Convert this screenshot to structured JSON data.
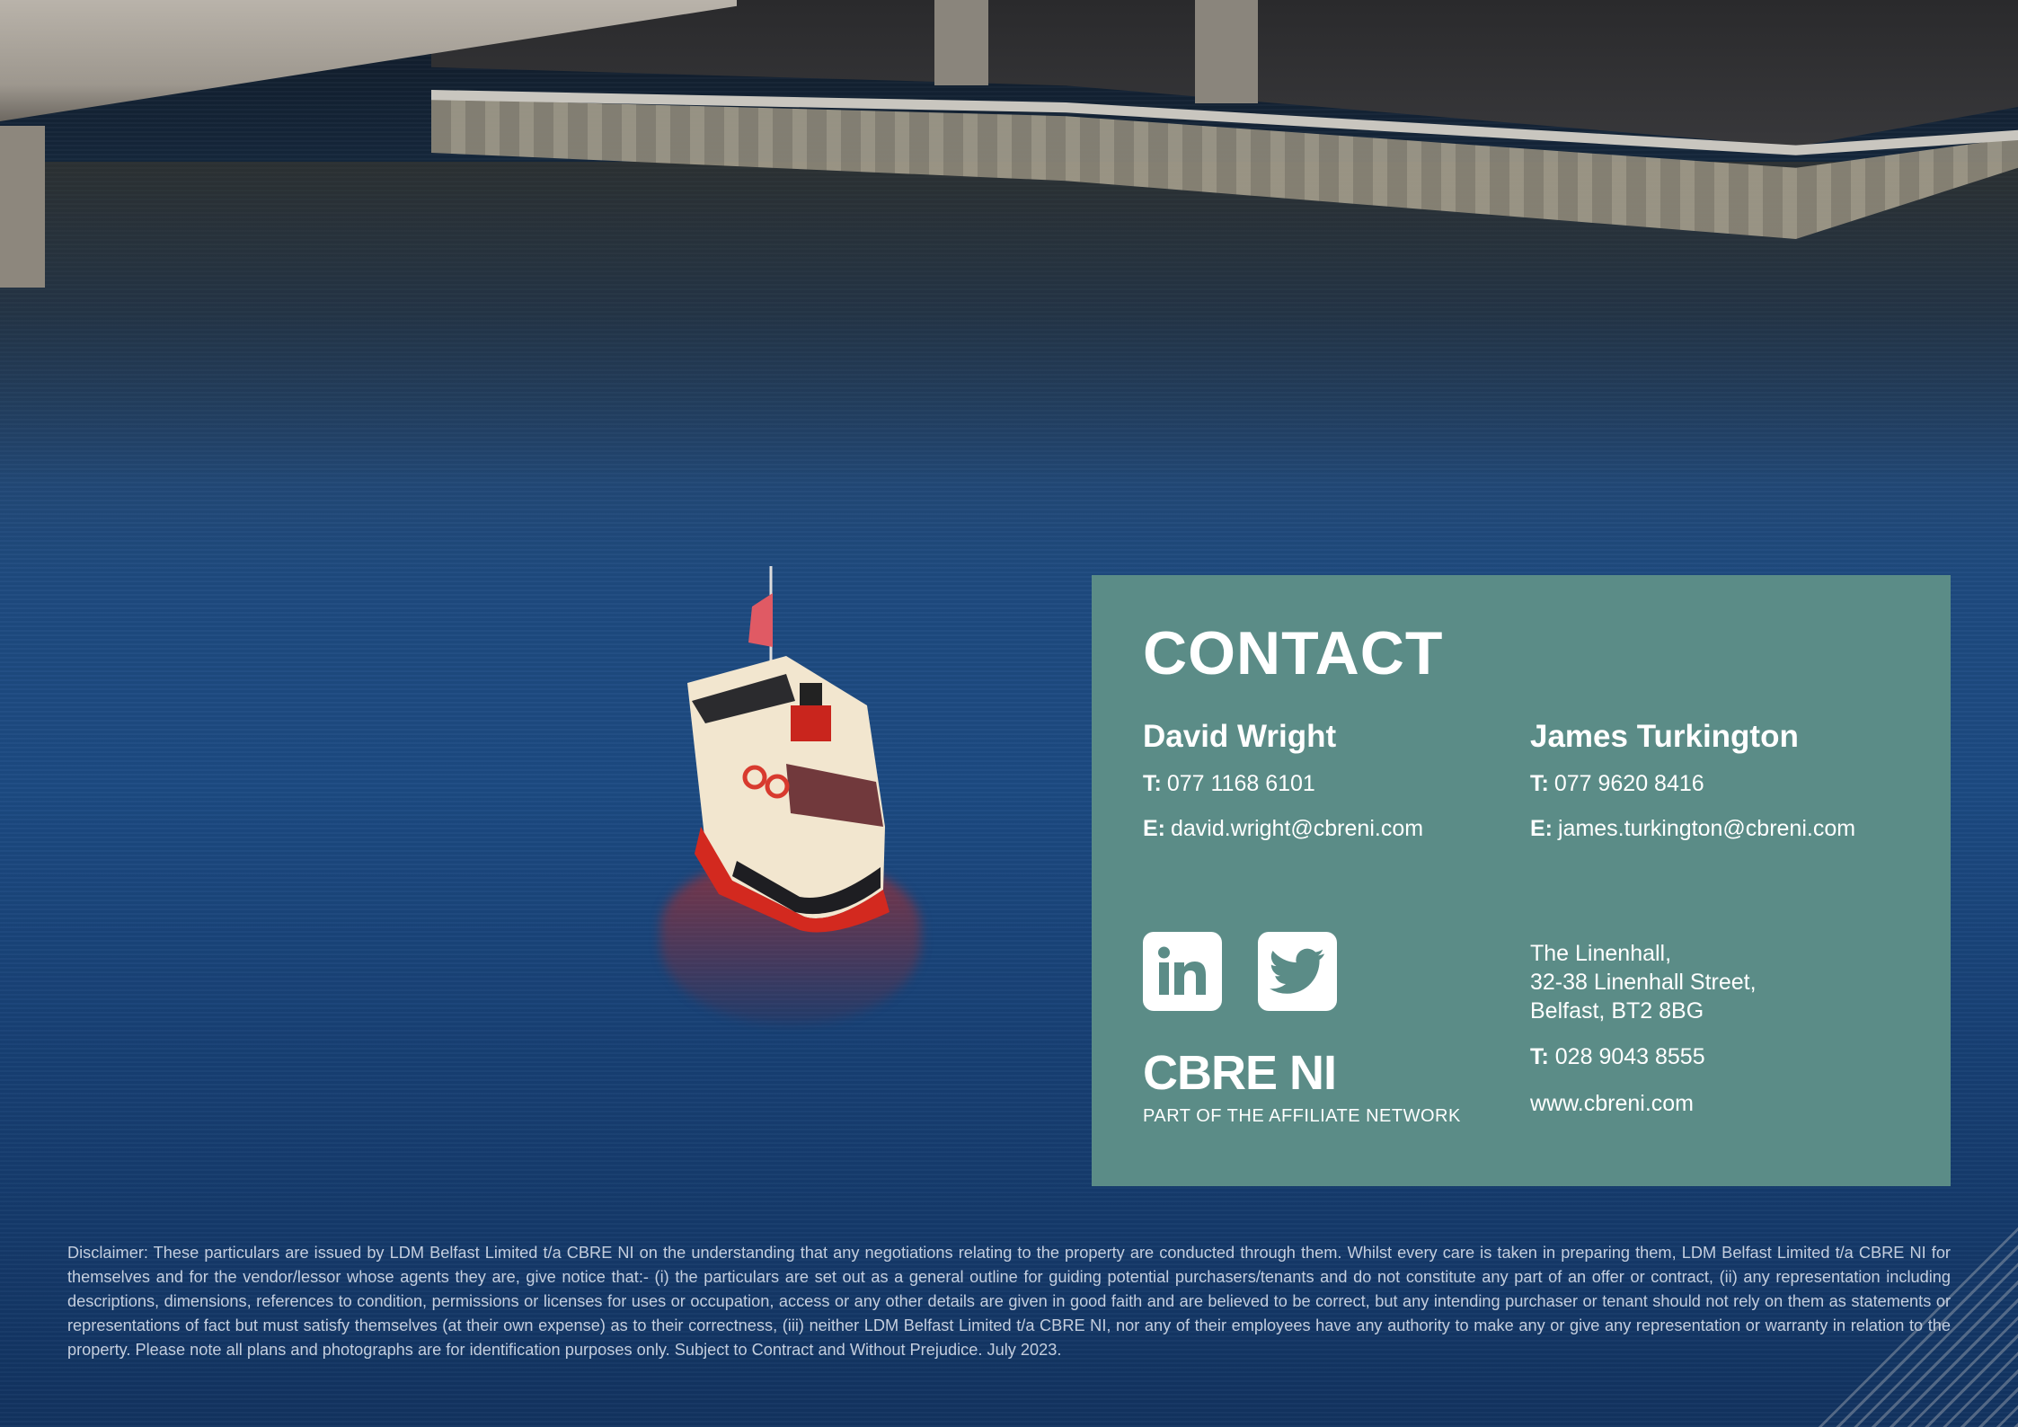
{
  "contact": {
    "title": "CONTACT",
    "people": [
      {
        "name": "David Wright",
        "phone_label": "T:",
        "phone": "077 1168 6101",
        "email_label": "E:",
        "email": "david.wright@cbreni.com"
      },
      {
        "name": "James Turkington",
        "phone_label": "T:",
        "phone": "077 9620 8416",
        "email_label": "E:",
        "email": "james.turkington@cbreni.com"
      }
    ],
    "social": [
      {
        "name": "linkedin",
        "icon": "linkedin-icon"
      },
      {
        "name": "twitter",
        "icon": "twitter-icon"
      }
    ],
    "logo": {
      "text": "CBRE NI",
      "tagline": "PART OF THE AFFILIATE NETWORK"
    },
    "office": {
      "address_lines": [
        "The Linenhall,",
        "32-38 Linenhall Street,",
        "Belfast, BT2 8BG"
      ],
      "phone_label": "T:",
      "phone": "028 9043 8555",
      "website": "www.cbreni.com"
    },
    "colors": {
      "panel": "#5b8c87",
      "text": "#ffffff"
    }
  },
  "disclaimer": "Disclaimer: These particulars are issued by LDM Belfast Limited t/a CBRE NI on the understanding that any negotiations relating to the property are conducted through them. Whilst every care is taken in preparing them, LDM Belfast Limited t/a CBRE NI for themselves and for the vendor/lessor whose agents they are, give notice that:- (i) the particulars are set out as a general outline for guiding potential purchasers/tenants and do not constitute any part of an offer or contract, (ii) any representation including descriptions, dimensions, references to condition, permissions or licenses for uses or occupation, access or any other details are given in good faith and are believed to be correct, but any intending purchaser or tenant should not rely on them as statements or representations of fact but must satisfy themselves (at their own expense) as to their correctness, (iii) neither LDM Belfast Limited t/a CBRE NI, nor any of their employees have any authority to make any or give any representation or warranty in relation to the property. Please note all plans and photographs are for identification purposes only. Subject to Contract and Without Prejudice. July 2023."
}
